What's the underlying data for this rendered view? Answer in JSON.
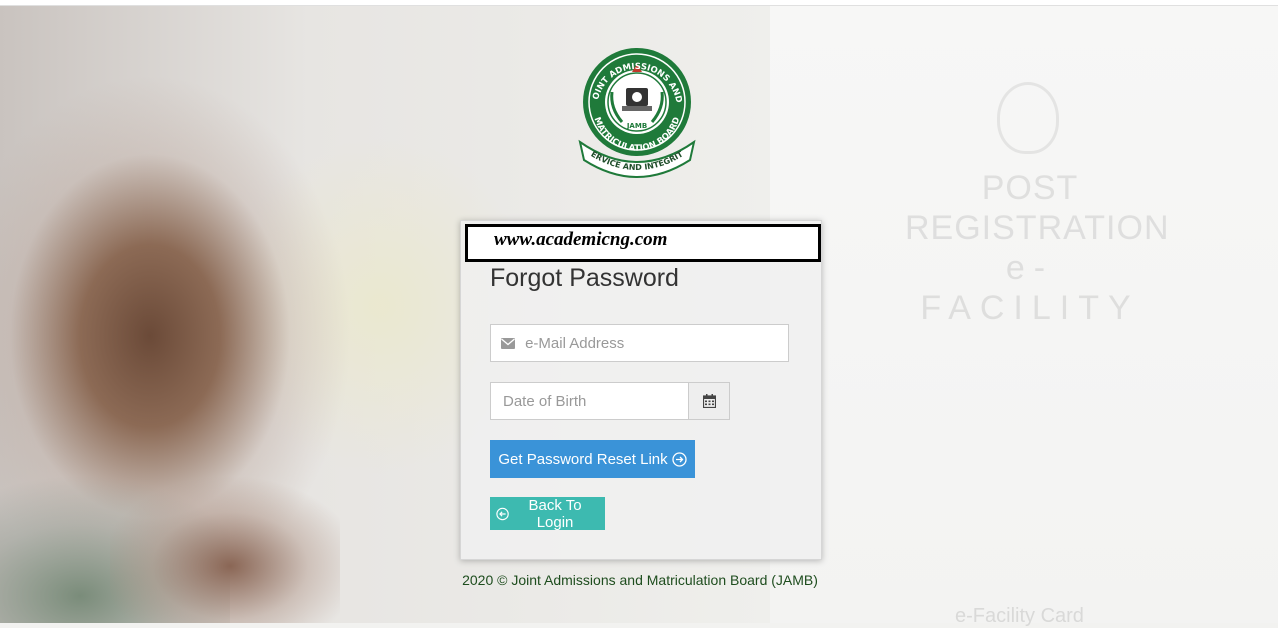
{
  "watermark": "www.academicng.com",
  "logo": {
    "top_text": "JOINT ADMISSIONS AND",
    "bottom_text": "MATRICULATION BOARD",
    "center_text": "JAMB",
    "ribbon_text": "SERVICE AND INTEGRITY"
  },
  "background": {
    "ghost_line1": "POST",
    "ghost_line2": "REGISTRATION",
    "ghost_line3": "e-FACILITY",
    "ghost_footer": "e-Facility Card"
  },
  "form": {
    "title": "Forgot Password",
    "email_placeholder": "e-Mail Address",
    "dob_placeholder": "Date of Birth",
    "reset_label": "Get Password Reset Link",
    "back_label": "Back To Login"
  },
  "footer": "2020 © Joint Admissions and Matriculation Board (JAMB)",
  "colors": {
    "primary": "#3a93d8",
    "secondary": "#3dbab0",
    "brand_green": "#1f7a3a"
  },
  "icons": [
    "envelope-icon",
    "calendar-icon",
    "arrow-circle-right-icon",
    "arrow-circle-left-icon"
  ]
}
